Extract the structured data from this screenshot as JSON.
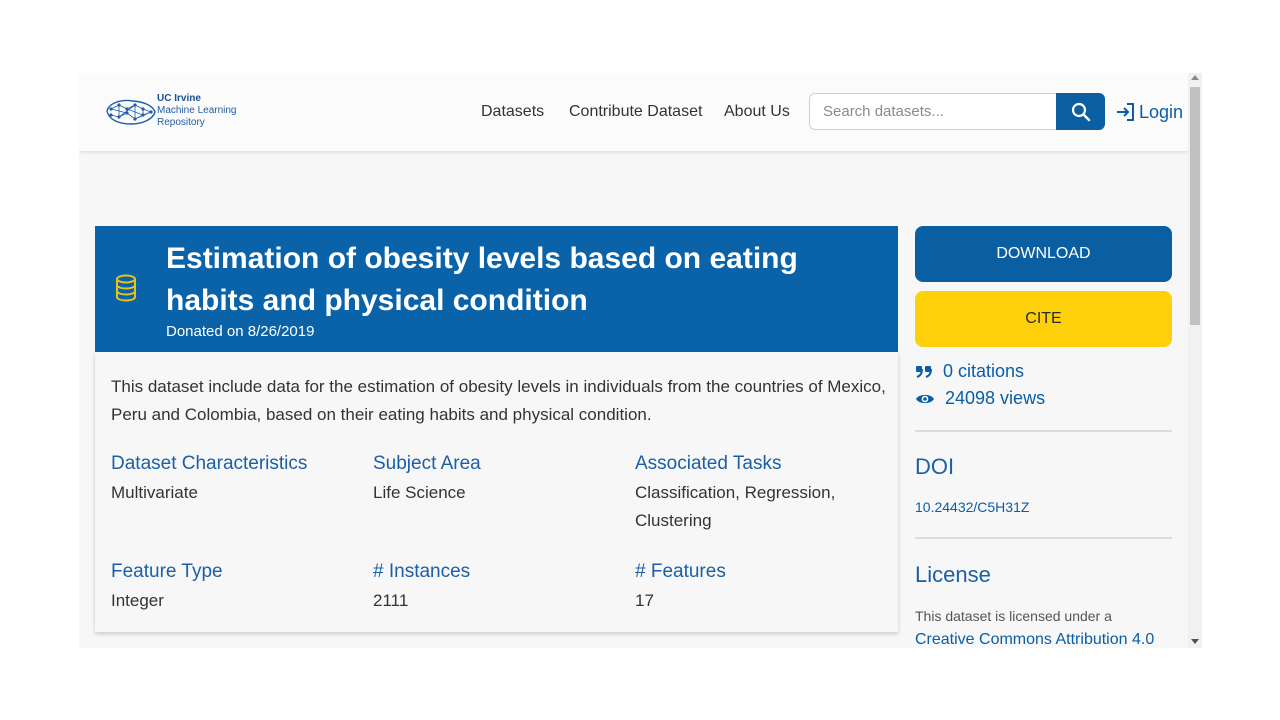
{
  "header": {
    "logo": {
      "line1": "UC Irvine",
      "line2": "Machine Learning",
      "line3": "Repository"
    },
    "nav": [
      "Datasets",
      "Contribute Dataset",
      "About Us"
    ],
    "search": {
      "placeholder": "Search datasets...",
      "value": "",
      "icon": "search-icon"
    },
    "login_label": "Login"
  },
  "dataset": {
    "title": "Estimation of obesity levels based on eating habits and physical condition",
    "donated": "Donated on 8/26/2019",
    "description": "This dataset include data for the estimation of obesity levels in individuals from the countries of Mexico, Peru and Colombia, based on their eating habits and physical condition.",
    "attributes": [
      {
        "label": "Dataset Characteristics",
        "value": "Multivariate"
      },
      {
        "label": "Subject Area",
        "value": "Life Science"
      },
      {
        "label": "Associated Tasks",
        "value": "Classification, Regression, Clustering"
      },
      {
        "label": "Feature Type",
        "value": "Integer"
      },
      {
        "label": "# Instances",
        "value": "2111"
      },
      {
        "label": "# Features",
        "value": "17"
      }
    ]
  },
  "sidebar": {
    "download_label": "DOWNLOAD",
    "cite_label": "CITE",
    "citations": "0 citations",
    "views": "24098 views",
    "doi_heading": "DOI",
    "doi_value": "10.24432/C5H31Z",
    "license_heading": "License",
    "license_text": "This dataset is licensed under a",
    "license_link": "Creative Commons Attribution 4.0"
  },
  "colors": {
    "primary": "#0a63a8",
    "accent_yellow": "#fdd00a",
    "link": "#0b5ea6",
    "icon_gold": "#e5c31a"
  }
}
